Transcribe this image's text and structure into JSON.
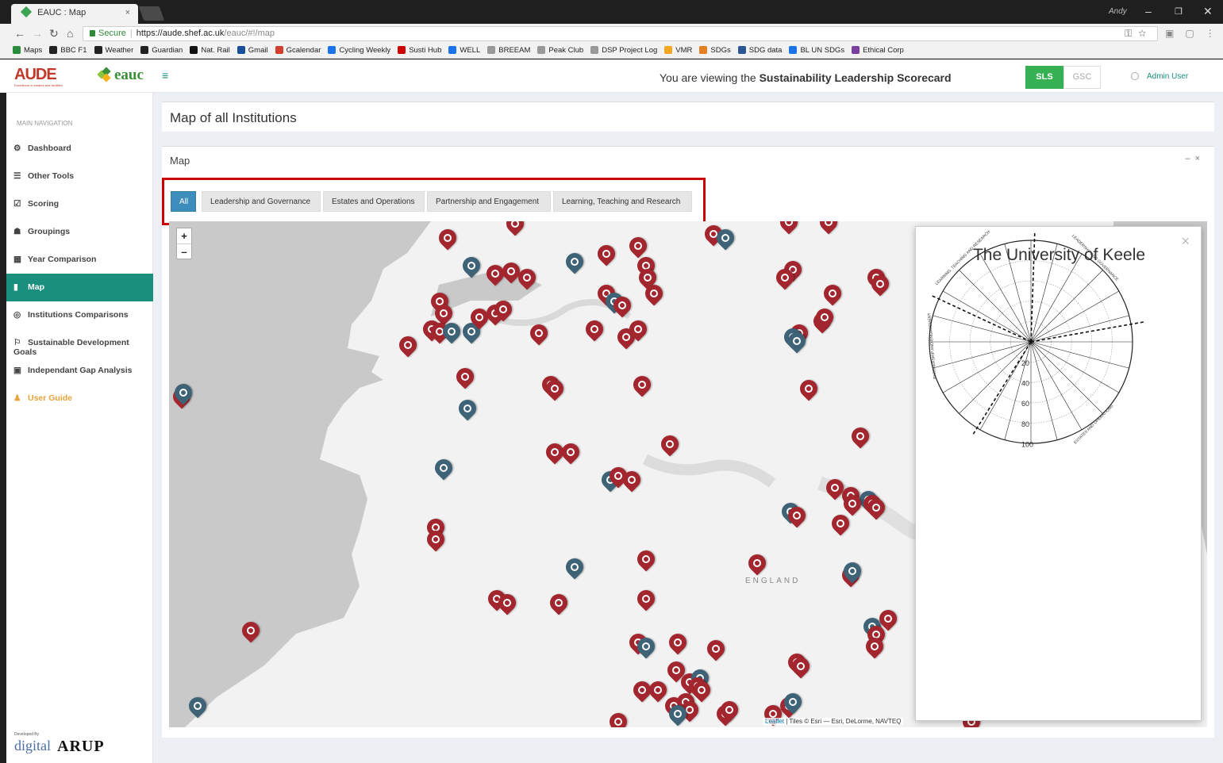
{
  "browser": {
    "tab_title": "EAUC : Map",
    "tab_close": "×",
    "window_user": "Andy",
    "secure_label": "Secure",
    "url_host": "https://aude.shef.ac.uk",
    "url_path": "/eauc/#!/map",
    "bookmarks": [
      "Maps",
      "BBC F1",
      "Weather",
      "Guardian",
      "Nat. Rail",
      "Gmail",
      "Gcalendar",
      "Cycling Weekly",
      "Susti Hub",
      "WELL",
      "BREEAM",
      "Peak Club",
      "DSP Project Log",
      "VMR",
      "SDGs",
      "SDG data",
      "BL UN SDGs",
      "Ethical Corp"
    ],
    "bookmark_colors": [
      "#2a8c3c",
      "#222222",
      "#222222",
      "#222222",
      "#111111",
      "#1a4f9c",
      "#d33f2f",
      "#1a73e8",
      "#cc0000",
      "#1a73e8",
      "#999999",
      "#999999",
      "#999999",
      "#f5a623",
      "#e67e22",
      "#2b5797",
      "#1a73e8",
      "#7b3fa0",
      "#2b5797"
    ]
  },
  "header": {
    "aude_logo": "AUDE",
    "aude_tagline": "Excellence in estates and facilities",
    "eauc_logo": "eauc",
    "hamburger": "≡",
    "viewing_prefix": "You are viewing the ",
    "viewing_bold": "Sustainability Leadership Scorecard",
    "sls": "SLS",
    "gsc": "GSC",
    "user": "Admin User"
  },
  "sidebar": {
    "header": "MAIN NAVIGATION",
    "items": [
      {
        "label": "Dashboard",
        "icon": "⚙"
      },
      {
        "label": "Other Tools",
        "icon": "☰"
      },
      {
        "label": "Scoring",
        "icon": "☑"
      },
      {
        "label": "Groupings",
        "icon": "☗"
      },
      {
        "label": "Year Comparison",
        "icon": "▦"
      },
      {
        "label": "Map",
        "icon": "▮"
      },
      {
        "label": "Institutions Comparisons",
        "icon": "◎"
      },
      {
        "label": "Sustainable Development Goals",
        "icon": "⚐"
      },
      {
        "label": "Independant Gap Analysis",
        "icon": "▣"
      },
      {
        "label": "User Guide",
        "icon": "♟"
      }
    ],
    "developed_by": "Developed By",
    "dev_digital": "digital",
    "dev_arup": "ARUP"
  },
  "main": {
    "page_title": "Map of all Institutions",
    "box_title": "Map",
    "box_tools": "– ×",
    "filters": [
      "All",
      "Leadership and Governance",
      "Estates and Operations",
      "Partnership and Engagement",
      "Learning, Teaching and Research"
    ],
    "active_filter": "All",
    "zoom_in": "+",
    "zoom_out": "–",
    "map_label": "ENGLAND",
    "attribution_leaflet": "Leaflet",
    "attribution_rest": " | Tiles © Esri — Esri, DeLorme, NAVTEQ"
  },
  "popup": {
    "close": "×",
    "title": "The University of Keele",
    "radar_labels": [
      "LEADERSHIP AND GOVERNANCE",
      "ESTATES AND OPERATIONS",
      "PARTNERSHIP AND ENGAGEMENT",
      "LEARNING, TEACHING AND RESEARCH"
    ],
    "radial_ticks": [
      "20",
      "40",
      "60",
      "80",
      "100"
    ]
  },
  "colors": {
    "accent": "#1a8f7d",
    "sls_green": "#35b153",
    "marker_red": "#a3262e",
    "marker_blue": "#3e6276",
    "filter_active": "#3c8dbc",
    "highlight_border": "#cc0000"
  }
}
